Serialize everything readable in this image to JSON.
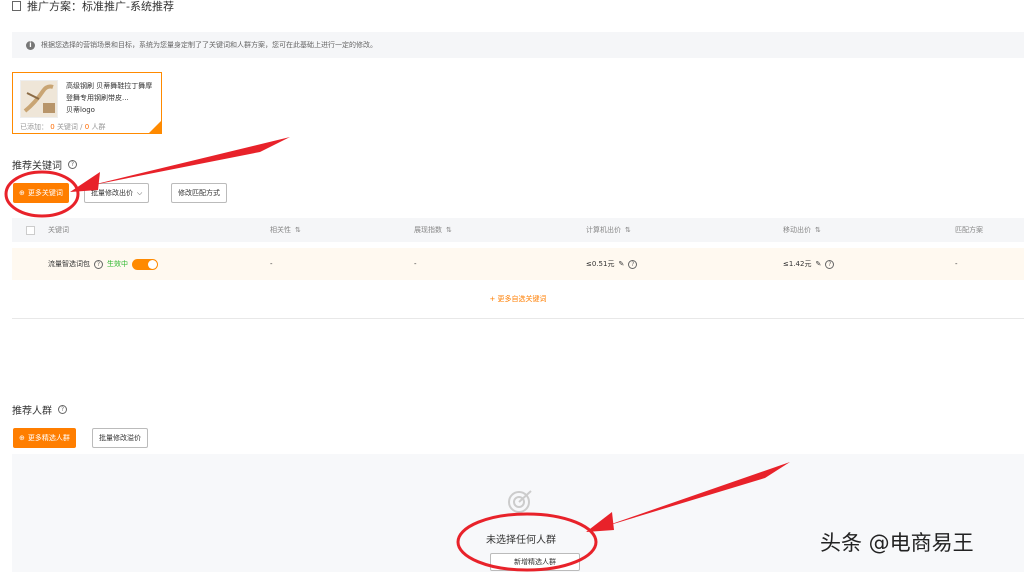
{
  "header": {
    "title": "推广方案：标准推广-系统推荐"
  },
  "info_bar": {
    "text": "根据您选择的营销场景和目标，系统为您量身定制了了关键词和人群方案，您可在此基础上进行一定的修改。"
  },
  "product_card": {
    "name": "高级钢刷 贝蒂舞鞋拉丁舞摩登舞专用钢刷带皮...",
    "logo_text": "贝蒂logo",
    "added_label": "已添加：",
    "keyword_count": "0",
    "keyword_label": "关键词",
    "separator": "/",
    "crowd_count": "0",
    "crowd_label": "人群"
  },
  "keywords_section": {
    "title": "推荐关键词",
    "more_button": "更多关键词",
    "bulk_bid_button": "批量修改出价",
    "match_button": "修改匹配方式",
    "columns": [
      "关键词",
      "相关性",
      "展现指数",
      "计算机出价",
      "移动出价",
      "匹配方案"
    ],
    "row": {
      "keyword": "流量智选词包",
      "status": "生效中",
      "relevance": "-",
      "impressions": "-",
      "pc_bid": "≤0.51元",
      "mobile_bid": "≤1.42元",
      "match": "-"
    },
    "more_link": "+ 更多自选关键词"
  },
  "crowd_section": {
    "title": "推荐人群",
    "more_button": "更多精选人群",
    "bulk_button": "批量修改溢价",
    "empty_text": "未选择任何人群",
    "add_button": "新增精选人群"
  },
  "watermark": "头条 @电商易王",
  "colors": {
    "accent": "#ff7e00",
    "annotation_red": "#e8222a",
    "status_green": "#2eb82e"
  }
}
